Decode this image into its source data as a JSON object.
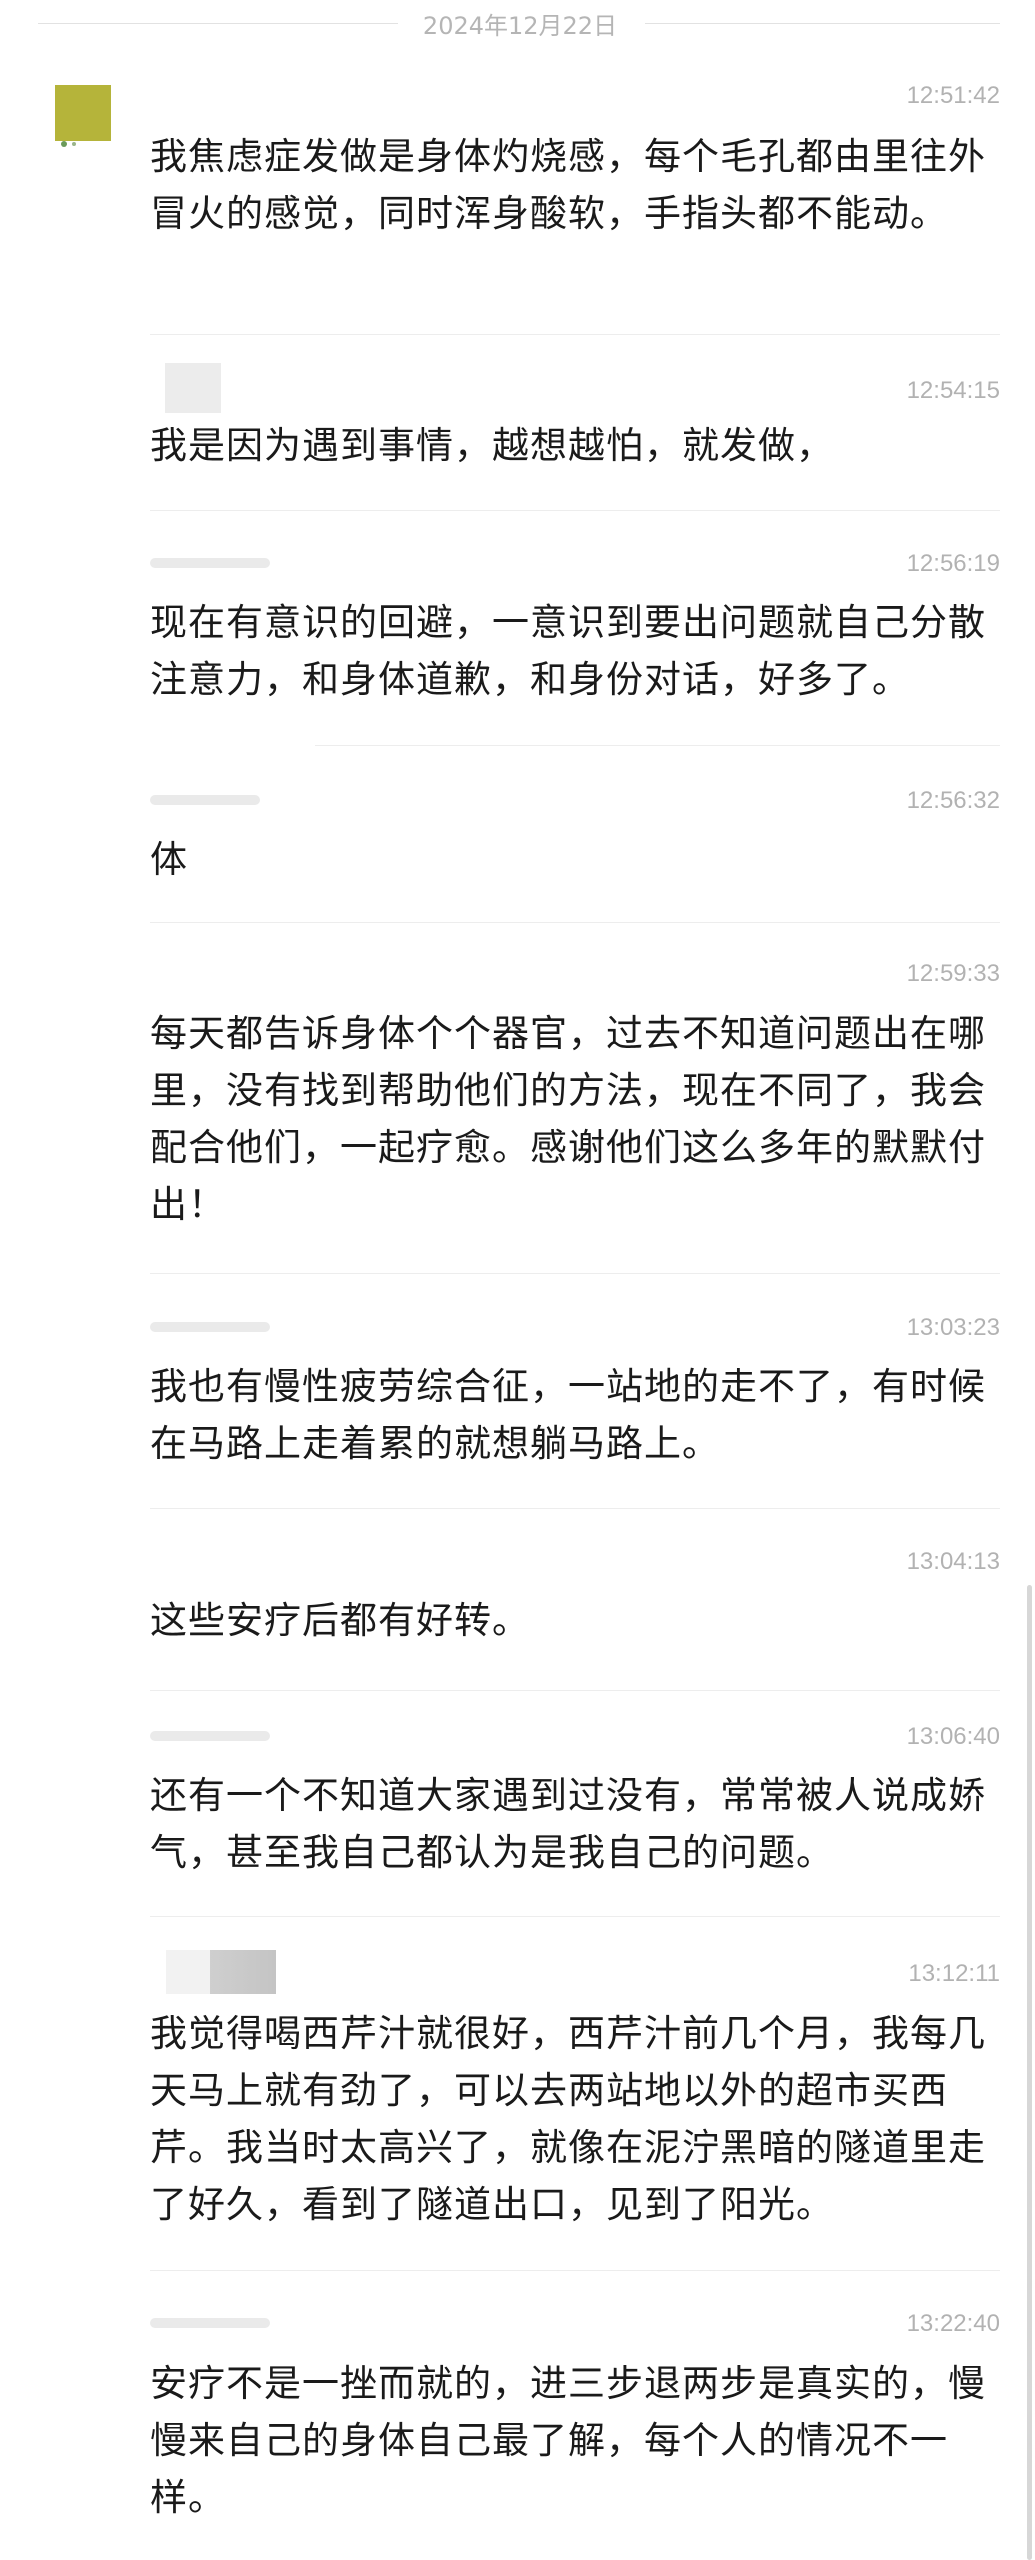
{
  "date": "2024年12月22日",
  "messages": [
    {
      "time": "12:51:42",
      "text": "我焦虑症发做是身体灼烧感，每个毛孔都由里往外冒火的感觉，同时浑身酸软，手指头都不能动。"
    },
    {
      "time": "12:54:15",
      "text": "我是因为遇到事情，越想越怕，就发做，"
    },
    {
      "time": "12:56:19",
      "text": "现在有意识的回避，一意识到要出问题就自己分散注意力，和身体道歉，和身份对话，好多了。"
    },
    {
      "time": "12:56:32",
      "text": "体"
    },
    {
      "time": "12:59:33",
      "text": "每天都告诉身体个个器官，过去不知道问题出在哪里，没有找到帮助他们的方法，现在不同了，我会配合他们，一起疗愈。感谢他们这么多年的默默付出！"
    },
    {
      "time": "13:03:23",
      "text": "我也有慢性疲劳综合征，一站地的走不了，有时候在马路上走着累的就想躺马路上。"
    },
    {
      "time": "13:04:13",
      "text": "这些安疗后都有好转。"
    },
    {
      "time": "13:06:40",
      "text": "还有一个不知道大家遇到过没有，常常被人说成娇气，甚至我自己都认为是我自己的问题。"
    },
    {
      "time": "13:12:11",
      "text": "我觉得喝西芹汁就很好，西芹汁前几个月，我每几天马上就有劲了，可以去两站地以外的超市买西芹。我当时太高兴了，就像在泥泞黑暗的隧道里走了好久，看到了隧道出口，见到了阳光。"
    },
    {
      "time": "13:22:40",
      "text": "安疗不是一挫而就的，进三步退两步是真实的，慢慢来自己的身体自己最了解，每个人的情况不一样。"
    }
  ]
}
